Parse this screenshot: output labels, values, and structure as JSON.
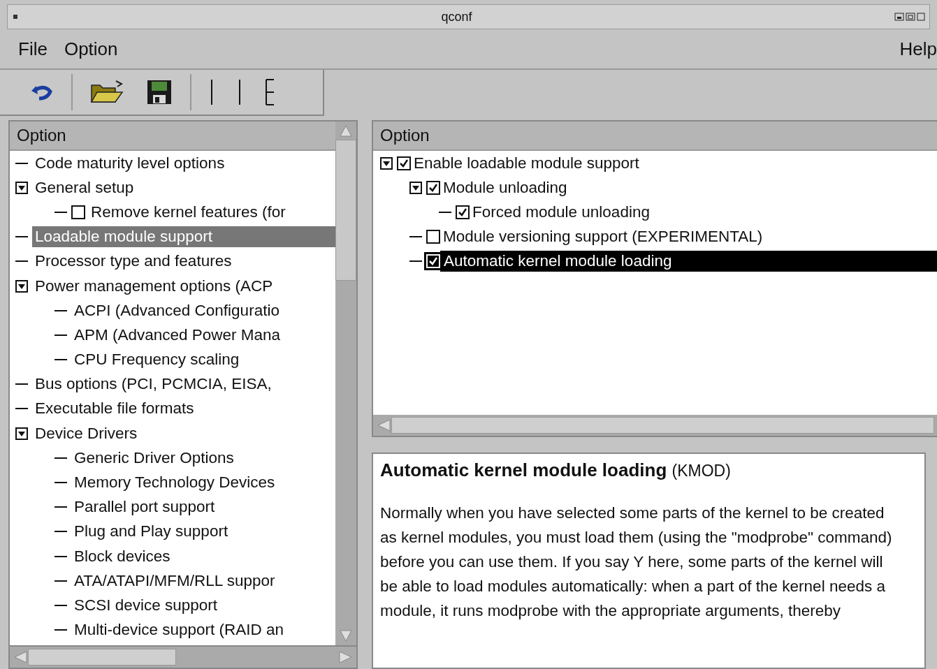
{
  "window": {
    "title": "qconf"
  },
  "menu": [
    {
      "label": "File"
    },
    {
      "label": "Option"
    },
    {
      "label": "Help"
    }
  ],
  "toolbar": [
    {
      "kind": "back"
    },
    {
      "kind": "open"
    },
    {
      "kind": "save"
    },
    {
      "kind": "single"
    },
    {
      "kind": "split"
    },
    {
      "kind": "full"
    }
  ],
  "left_tree": {
    "header": "Option",
    "items": [
      {
        "label": "Code maturity level options",
        "kind": "menu",
        "selected": false
      },
      {
        "label": "General setup",
        "kind": "menu",
        "selected": false,
        "expanded": true,
        "children": [
          {
            "label": "Remove kernel features (for",
            "kind": "checkbox",
            "checked": false,
            "selected": false
          }
        ]
      },
      {
        "label": "Loadable module support",
        "kind": "menu",
        "selected": true
      },
      {
        "label": "Processor type and features",
        "kind": "menu",
        "selected": false
      },
      {
        "label": "Power management options (ACP",
        "kind": "menu",
        "selected": false,
        "expanded": true,
        "children": [
          {
            "label": "ACPI (Advanced Configuratio",
            "kind": "menu",
            "selected": false
          },
          {
            "label": "APM (Advanced Power Mana",
            "kind": "menu",
            "selected": false
          },
          {
            "label": "CPU Frequency scaling",
            "kind": "menu",
            "selected": false
          }
        ]
      },
      {
        "label": "Bus options (PCI, PCMCIA, EISA,",
        "kind": "menu",
        "selected": false
      },
      {
        "label": "Executable file formats",
        "kind": "menu",
        "selected": false
      },
      {
        "label": "Device Drivers",
        "kind": "menu",
        "selected": false,
        "expanded": true,
        "children": [
          {
            "label": "Generic Driver Options",
            "kind": "menu",
            "selected": false
          },
          {
            "label": "Memory Technology Devices",
            "kind": "menu",
            "selected": false
          },
          {
            "label": "Parallel port support",
            "kind": "menu",
            "selected": false
          },
          {
            "label": "Plug and Play support",
            "kind": "menu",
            "selected": false
          },
          {
            "label": "Block devices",
            "kind": "menu",
            "selected": false
          },
          {
            "label": "ATA/ATAPI/MFM/RLL suppor",
            "kind": "menu",
            "selected": false
          },
          {
            "label": "SCSI device support",
            "kind": "menu",
            "selected": false
          },
          {
            "label": "Multi-device support (RAID an",
            "kind": "menu",
            "selected": false
          }
        ]
      }
    ]
  },
  "right_tree": {
    "header": "Option",
    "items": [
      {
        "label": "Enable loadable module support",
        "kind": "checkbox",
        "checked": true,
        "selected": false,
        "expanded": true,
        "children": [
          {
            "label": "Module unloading",
            "kind": "checkbox",
            "checked": true,
            "selected": false,
            "expanded": true,
            "children": [
              {
                "label": "Forced module unloading",
                "kind": "checkbox",
                "checked": true,
                "selected": false
              }
            ]
          },
          {
            "label": "Module versioning support (EXPERIMENTAL)",
            "kind": "checkbox",
            "checked": false,
            "selected": false
          },
          {
            "label": "Automatic kernel module loading",
            "kind": "checkbox",
            "checked": true,
            "selected": true
          }
        ]
      }
    ]
  },
  "help": {
    "title": "Automatic kernel module loading",
    "symbol": "(KMOD)",
    "text": "Normally when you have selected some parts of the kernel to be created as kernel modules, you must load them (using the \"modprobe\" command) before you can use them. If you say Y here, some parts of the kernel will be able to load modules automatically: when a part of the kernel needs a module, it runs modprobe with the appropriate arguments, thereby"
  }
}
